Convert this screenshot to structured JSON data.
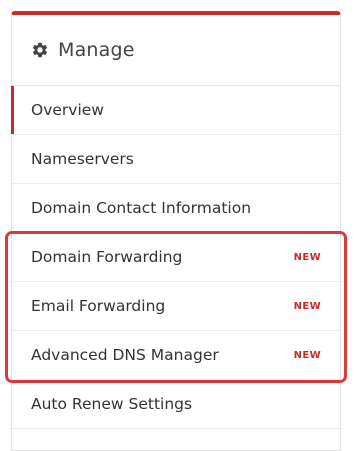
{
  "manage": {
    "title": "Manage",
    "icon": "gear-icon",
    "accent_color": "#cc2a2a",
    "items": [
      {
        "label": "Overview",
        "active": true,
        "badge": ""
      },
      {
        "label": "Nameservers",
        "active": false,
        "badge": ""
      },
      {
        "label": "Domain Contact Information",
        "active": false,
        "badge": ""
      },
      {
        "label": "Domain Forwarding",
        "active": false,
        "badge": "NEW"
      },
      {
        "label": "Email Forwarding",
        "active": false,
        "badge": "NEW"
      },
      {
        "label": "Advanced DNS Manager",
        "active": false,
        "badge": "NEW"
      },
      {
        "label": "Auto Renew Settings",
        "active": false,
        "badge": ""
      }
    ]
  },
  "highlight": {
    "color": "#d93a3a"
  }
}
